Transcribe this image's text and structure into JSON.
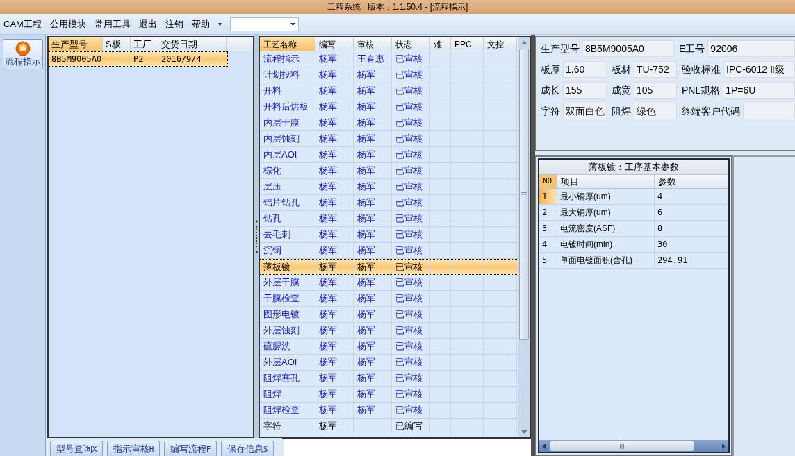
{
  "window": {
    "title": "工程系统   版本：1.1.50.4 - [流程指示]"
  },
  "menu": [
    "CAM工程",
    "公用模块",
    "常用工具",
    "退出",
    "注销",
    "帮助"
  ],
  "menu_overflow": "▾",
  "sidebar": {
    "button": "流程指示"
  },
  "model_list": {
    "columns": [
      {
        "label": "生产型号",
        "selected": true
      },
      {
        "label": "S板",
        "selected": false
      },
      {
        "label": "工厂",
        "selected": false
      },
      {
        "label": "交货日期",
        "selected": false
      }
    ],
    "rows": [
      {
        "cells": [
          "8B5M9005A0",
          "",
          "P2",
          "2016/9/4"
        ],
        "selected": true
      }
    ]
  },
  "buttons": [
    {
      "label": "型号查询",
      "key": "X"
    },
    {
      "label": "指示审核",
      "key": "H"
    },
    {
      "label": "编写流程",
      "key": "F"
    },
    {
      "label": "保存信息",
      "key": "S"
    }
  ],
  "process_table": {
    "columns": [
      {
        "label": "工艺名称",
        "selected": true
      },
      {
        "label": "编写",
        "selected": false
      },
      {
        "label": "审核",
        "selected": false
      },
      {
        "label": "状态",
        "selected": false
      },
      {
        "label": "难",
        "selected": false
      },
      {
        "label": "PPC",
        "selected": false
      },
      {
        "label": "文控",
        "selected": false
      }
    ],
    "rows": [
      {
        "cells": [
          "流程指示",
          "杨军",
          "王春惠",
          "已审核"
        ],
        "reviewed": true,
        "selected": false
      },
      {
        "cells": [
          "计划投料",
          "杨军",
          "杨军",
          "已审核"
        ],
        "reviewed": true,
        "selected": false
      },
      {
        "cells": [
          "开料",
          "杨军",
          "杨军",
          "已审核"
        ],
        "reviewed": true,
        "selected": false
      },
      {
        "cells": [
          "开料后烘板",
          "杨军",
          "杨军",
          "已审核"
        ],
        "reviewed": true,
        "selected": false
      },
      {
        "cells": [
          "内层干膜",
          "杨军",
          "杨军",
          "已审核"
        ],
        "reviewed": true,
        "selected": false
      },
      {
        "cells": [
          "内层蚀刻",
          "杨军",
          "杨军",
          "已审核"
        ],
        "reviewed": true,
        "selected": false
      },
      {
        "cells": [
          "内层AOI",
          "杨军",
          "杨军",
          "已审核"
        ],
        "reviewed": true,
        "selected": false
      },
      {
        "cells": [
          "棕化",
          "杨军",
          "杨军",
          "已审核"
        ],
        "reviewed": true,
        "selected": false
      },
      {
        "cells": [
          "层压",
          "杨军",
          "杨军",
          "已审核"
        ],
        "reviewed": true,
        "selected": false
      },
      {
        "cells": [
          "铝片钻孔",
          "杨军",
          "杨军",
          "已审核"
        ],
        "reviewed": true,
        "selected": false
      },
      {
        "cells": [
          "钻孔",
          "杨军",
          "杨军",
          "已审核"
        ],
        "reviewed": true,
        "selected": false
      },
      {
        "cells": [
          "去毛刺",
          "杨军",
          "杨军",
          "已审核"
        ],
        "reviewed": true,
        "selected": false
      },
      {
        "cells": [
          "沉铜",
          "杨军",
          "杨军",
          "已审核"
        ],
        "reviewed": true,
        "selected": false
      },
      {
        "cells": [
          "薄板镀",
          "杨军",
          "杨军",
          "已审核"
        ],
        "reviewed": true,
        "selected": true
      },
      {
        "cells": [
          "外层干膜",
          "杨军",
          "杨军",
          "已审核"
        ],
        "reviewed": true,
        "selected": false
      },
      {
        "cells": [
          "干膜检查",
          "杨军",
          "杨军",
          "已审核"
        ],
        "reviewed": true,
        "selected": false
      },
      {
        "cells": [
          "图形电镀",
          "杨军",
          "杨军",
          "已审核"
        ],
        "reviewed": true,
        "selected": false
      },
      {
        "cells": [
          "外层蚀刻",
          "杨军",
          "杨军",
          "已审核"
        ],
        "reviewed": true,
        "selected": false
      },
      {
        "cells": [
          "硫脲洗",
          "杨军",
          "杨军",
          "已审核"
        ],
        "reviewed": true,
        "selected": false
      },
      {
        "cells": [
          "外层AOI",
          "杨军",
          "杨军",
          "已审核"
        ],
        "reviewed": true,
        "selected": false
      },
      {
        "cells": [
          "阻焊塞孔",
          "杨军",
          "杨军",
          "已审核"
        ],
        "reviewed": true,
        "selected": false
      },
      {
        "cells": [
          "阻焊",
          "杨军",
          "杨军",
          "已审核"
        ],
        "reviewed": true,
        "selected": false
      },
      {
        "cells": [
          "阻焊检查",
          "杨军",
          "杨军",
          "已审核"
        ],
        "reviewed": true,
        "selected": false
      },
      {
        "cells": [
          "字符",
          "杨军",
          "",
          "已编写"
        ],
        "reviewed": false,
        "selected": false
      }
    ]
  },
  "info": [
    [
      {
        "label": "生产型号",
        "value": "8B5M9005A0"
      },
      {
        "label": "E工号",
        "value": "92006"
      }
    ],
    [
      {
        "label": "板厚",
        "value": "1.60"
      },
      {
        "label": "板材",
        "value": "TU-752"
      },
      {
        "label": "验收标准",
        "value": "IPC-6012 Ⅱ级"
      }
    ],
    [
      {
        "label": "成长",
        "value": "155"
      },
      {
        "label": "成宽",
        "value": "105"
      },
      {
        "label": "PNL规格",
        "value": "1P=6U"
      }
    ],
    [
      {
        "label": "字符",
        "value": "双面白色"
      },
      {
        "label": "阻焊",
        "value": "绿色"
      },
      {
        "label": "终端客户代码"
      }
    ]
  ],
  "params": {
    "title": "薄板镀：工序基本参数",
    "columns": [
      "NO",
      "项目",
      "参数"
    ],
    "rows": [
      {
        "cells": [
          "1",
          "最小铜厚(um)",
          "4"
        ],
        "selected": true
      },
      {
        "cells": [
          "2",
          "最大铜厚(um)",
          "6"
        ],
        "selected": false
      },
      {
        "cells": [
          "3",
          "电流密度(ASF)",
          "8"
        ],
        "selected": false
      },
      {
        "cells": [
          "4",
          "电镀时间(min)",
          "30"
        ],
        "selected": false
      },
      {
        "cells": [
          "5",
          "单面电镀面积(含孔)",
          "294.91"
        ],
        "selected": false
      }
    ]
  }
}
